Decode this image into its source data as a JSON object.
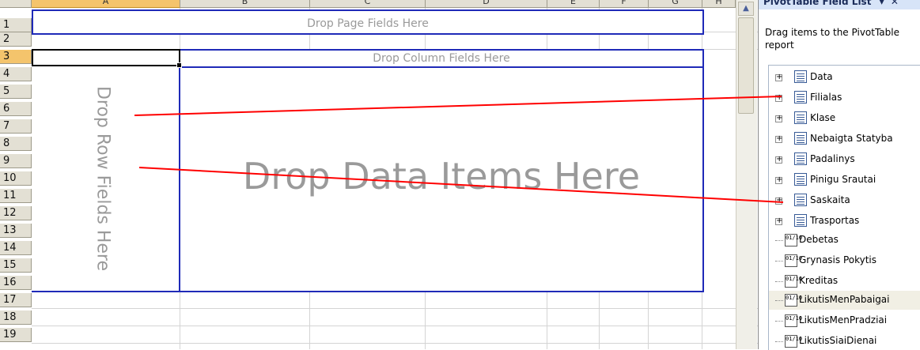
{
  "spreadsheet": {
    "columns": [
      "A",
      "B",
      "C",
      "D",
      "E",
      "F",
      "G",
      "H"
    ],
    "selected_column": "A",
    "rows": [
      "1",
      "2",
      "3",
      "4",
      "5",
      "6",
      "7",
      "8",
      "9",
      "10",
      "11",
      "12",
      "13",
      "14",
      "15",
      "16",
      "17",
      "18",
      "19"
    ],
    "selected_row": "3",
    "drop_zones": {
      "page": "Drop Page Fields Here",
      "column": "Drop Column Fields Here",
      "row": "Drop Row Fields Here",
      "data": "Drop Data Items Here"
    },
    "annotation_color": "#ff0000",
    "zone_border_color": "#1f2ab8"
  },
  "field_list": {
    "title": "PivotTable Field List",
    "description": "Drag items to the PivotTable report",
    "dimensions": [
      "Data",
      "Filialas",
      "Klase",
      "Nebaigta Statyba",
      "Padalinys",
      "Pinigu Srautai",
      "Saskaita",
      "Trasportas"
    ],
    "measures": [
      "Debetas",
      "Grynasis Pokytis",
      "Kreditas",
      "LikutisMenPabaigai",
      "LikutisMenPradziai",
      "LikutisSiaiDienai"
    ],
    "measure_icon": "01/10",
    "expand_symbol": "+"
  }
}
